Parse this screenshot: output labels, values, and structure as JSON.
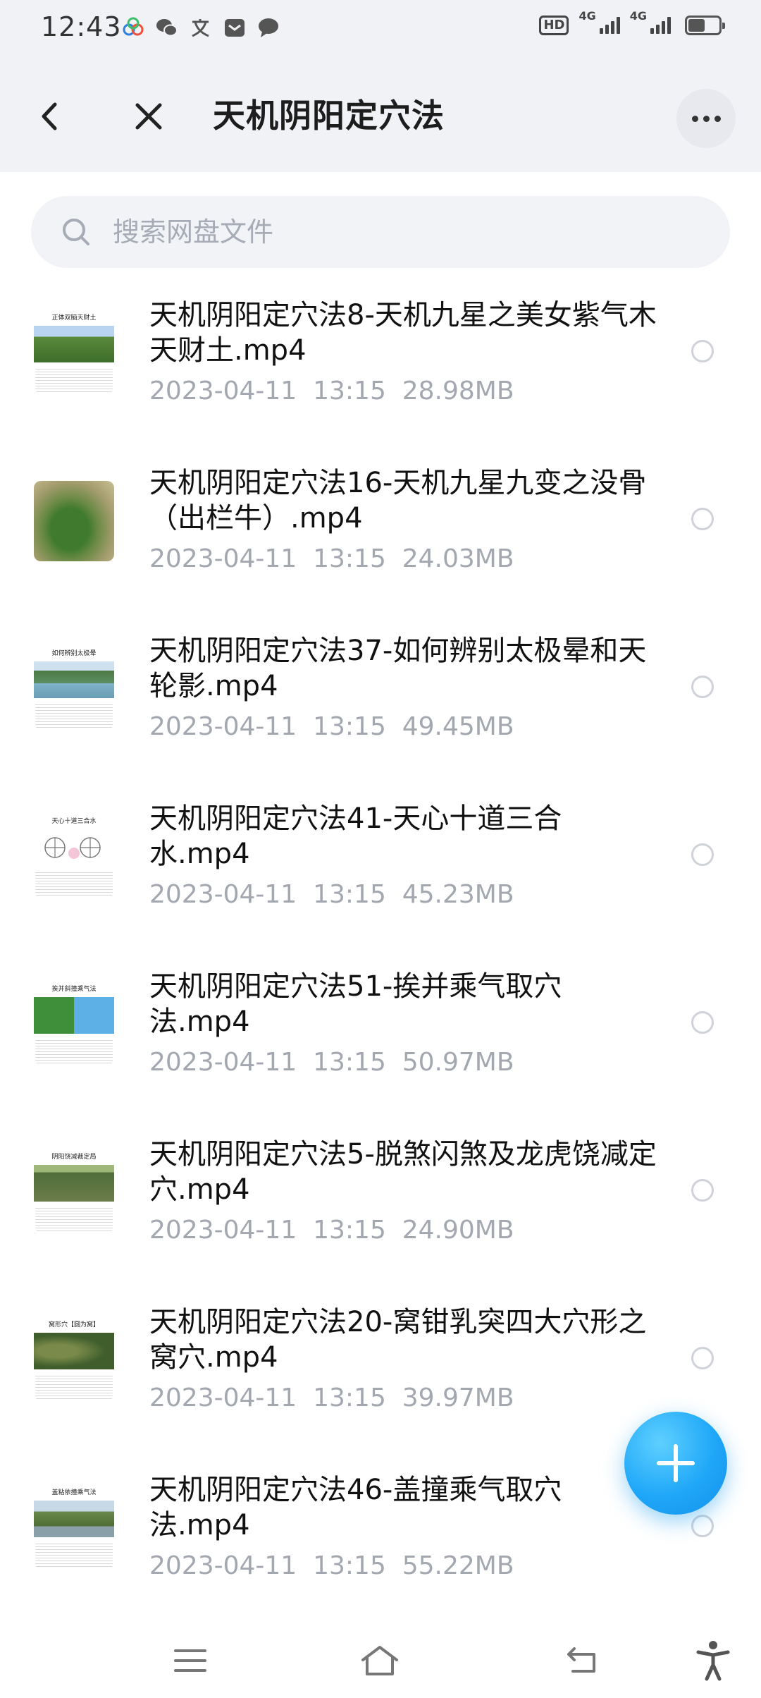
{
  "status_bar": {
    "time": "12:43",
    "notification_icons": [
      "baidu-netdisk-icon",
      "wechat-icon",
      "translate-icon",
      "mail-icon",
      "message-icon"
    ],
    "hd_label": "HD",
    "sim1_label": "4G",
    "sim2_label": "4G",
    "battery_level": 0.55
  },
  "header": {
    "title": "天机阴阳定穴法",
    "back_icon": "chevron-left-icon",
    "close_icon": "close-icon",
    "more_icon": "more-icon"
  },
  "search": {
    "placeholder": "搜索网盘文件",
    "value": ""
  },
  "files": [
    {
      "name": "天机阴阳定穴法8-天机九星之美女紫气木天财土.mp4",
      "date": "2023-04-11",
      "time": "13:15",
      "size": "28.98MB",
      "thumb_caption": "正体双脑天财土"
    },
    {
      "name": "天机阴阳定穴法16-天机九星九变之没骨（出栏牛）.mp4",
      "date": "2023-04-11",
      "time": "13:15",
      "size": "24.03MB",
      "thumb_caption": ""
    },
    {
      "name": "天机阴阳定穴法37-如何辨别太极晕和天轮影.mp4",
      "date": "2023-04-11",
      "time": "13:15",
      "size": "49.45MB",
      "thumb_caption": "如何辨别太极晕"
    },
    {
      "name": "天机阴阳定穴法41-天心十道三合水.mp4",
      "date": "2023-04-11",
      "time": "13:15",
      "size": "45.23MB",
      "thumb_caption": "天心十道三合水"
    },
    {
      "name": "天机阴阳定穴法51-挨并乘气取穴法.mp4",
      "date": "2023-04-11",
      "time": "13:15",
      "size": "50.97MB",
      "thumb_caption": "挨并斜撞乘气法"
    },
    {
      "name": "天机阴阳定穴法5-脱煞闪煞及龙虎饶减定穴.mp4",
      "date": "2023-04-11",
      "time": "13:15",
      "size": "24.90MB",
      "thumb_caption": "阴阳饶减裁定局"
    },
    {
      "name": "天机阴阳定穴法20-窝钳乳突四大穴形之窝穴.mp4",
      "date": "2023-04-11",
      "time": "13:15",
      "size": "39.97MB",
      "thumb_caption": "窝形穴【圆为窝】"
    },
    {
      "name": "天机阴阳定穴法46-盖撞乘气取穴法.mp4",
      "date": "2023-04-11",
      "time": "13:15",
      "size": "55.22MB",
      "thumb_caption": "盖粘依撞乘气法"
    }
  ],
  "fab": {
    "icon": "plus-icon"
  },
  "nav_bar": {
    "icons": [
      "menu-icon",
      "home-icon",
      "back-icon",
      "accessibility-icon"
    ]
  },
  "colors": {
    "accent": "#1fa7f8",
    "header_bg": "#f1f2f6",
    "meta_text": "#a3a7b0"
  }
}
